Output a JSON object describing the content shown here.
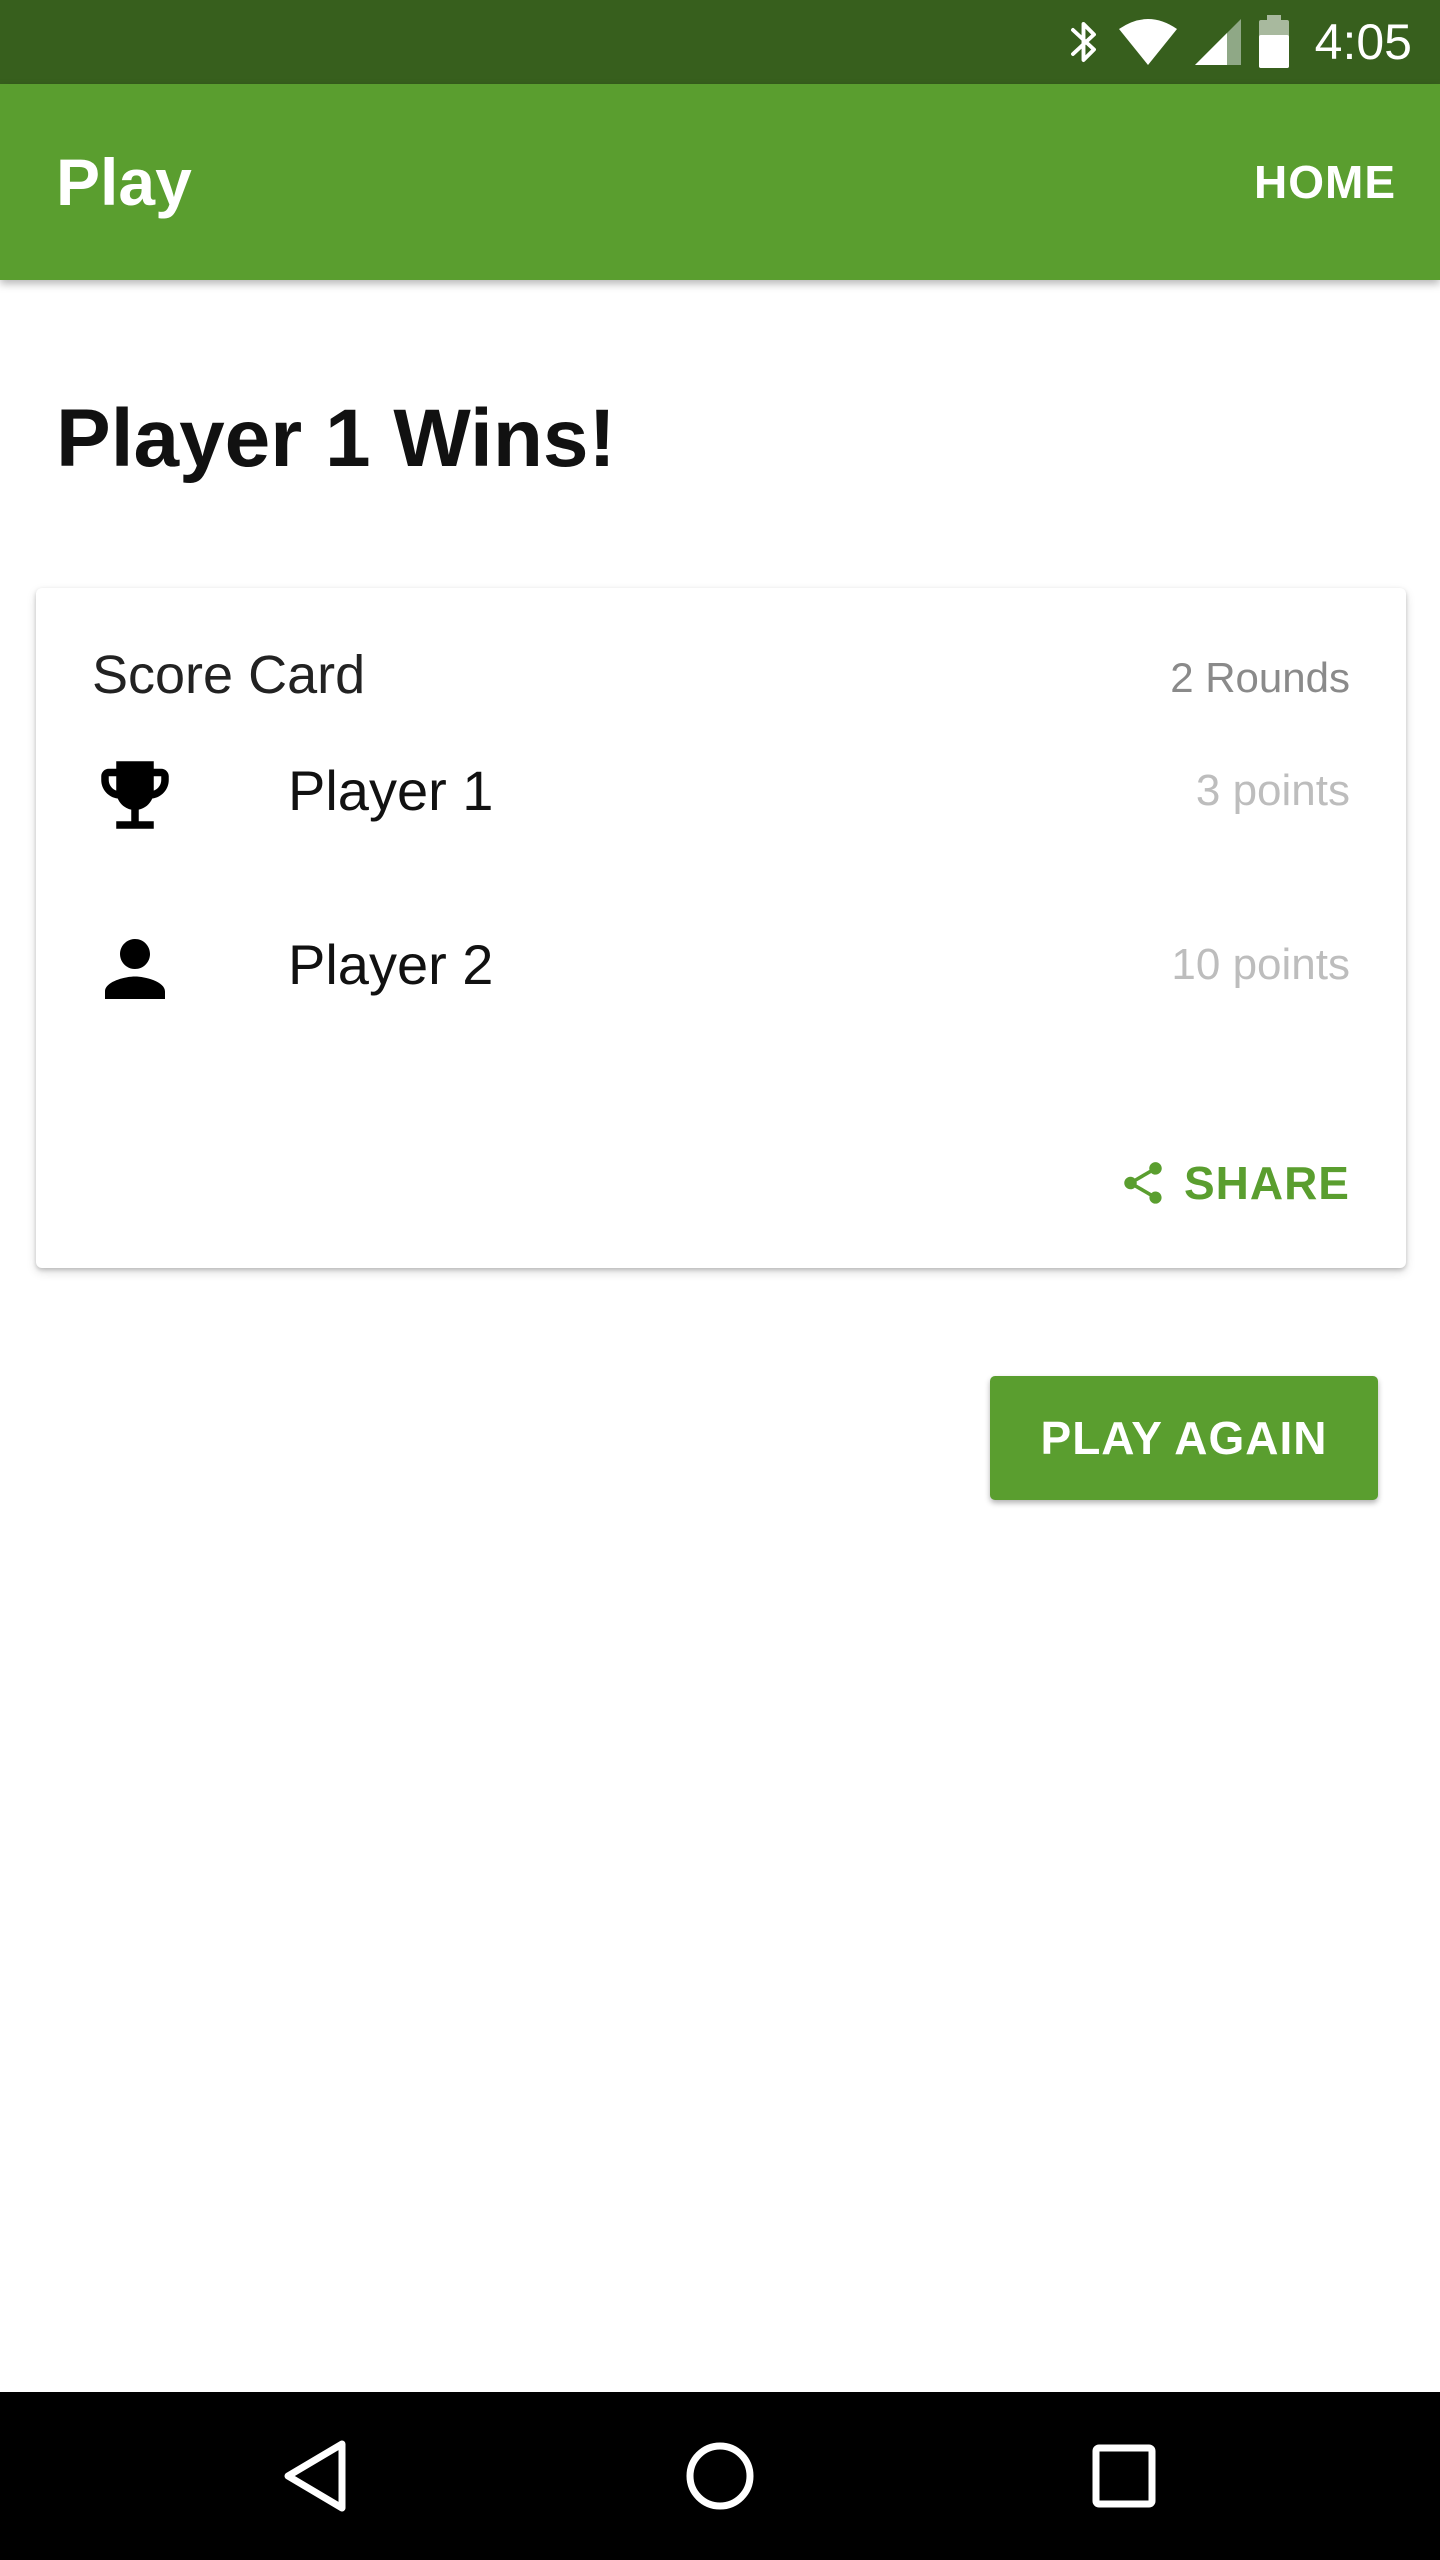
{
  "status_bar": {
    "time": "4:05",
    "icons": [
      "bluetooth-icon",
      "wifi-icon",
      "cell-signal-icon",
      "battery-icon"
    ]
  },
  "app_bar": {
    "title": "Play",
    "home_label": "HOME",
    "color": "#5a9e2f"
  },
  "main": {
    "heading": "Player 1 Wins!"
  },
  "score_card": {
    "title": "Score Card",
    "rounds": "2 Rounds",
    "players": [
      {
        "name": "Player 1",
        "points": "3 points",
        "icon": "trophy-icon"
      },
      {
        "name": "Player 2",
        "points": "10 points",
        "icon": "person-icon"
      }
    ],
    "share_label": "SHARE"
  },
  "actions": {
    "play_again_label": "PLAY AGAIN"
  },
  "nav_bar": {
    "buttons": [
      "back-icon",
      "home-circle-icon",
      "recents-icon"
    ]
  }
}
